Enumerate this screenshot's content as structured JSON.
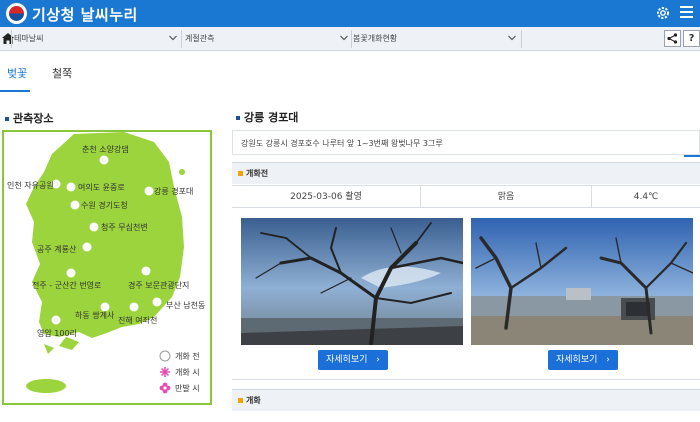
{
  "header": {
    "app_title": "기상청 날씨누리"
  },
  "breadcrumb": {
    "item1": "테마날씨",
    "item2": "계절관측",
    "item3": "봄꽃개화현황",
    "help_label": "?"
  },
  "tabs": [
    {
      "label": "벚꽃",
      "active": true
    },
    {
      "label": "철쭉",
      "active": false
    }
  ],
  "left": {
    "section_title": "관측장소",
    "stations": [
      "춘천 소양강댐",
      "인천 자유공원",
      "여의도 윤중로",
      "강릉 경포대",
      "수원 경기도청",
      "청주 무심천변",
      "공주 계룡산",
      "전주 - 군산간 번영로",
      "경주 보문관광단지",
      "부산 남천동",
      "하동 쌍계사",
      "진해 여좌천",
      "영암 100리"
    ],
    "legend": {
      "before": "개화 전",
      "bloom": "개화 시",
      "full": "만발 시"
    }
  },
  "right": {
    "station_title": "강릉 경포대",
    "address": "강원도 강릉시 경포호수 나루터 앞 1~3번째 왕벚나무 3그루",
    "before_section": {
      "title": "개화전",
      "date": "2025-03-06 촬영",
      "weather": "맑음",
      "temperature": "4.4℃",
      "button_label": "자세히보기"
    },
    "bloom_section": {
      "title": "개화"
    }
  },
  "colors": {
    "brand_blue": "#1a78d2",
    "map_green": "#9bd43c",
    "accent_orange": "#f0a400"
  }
}
